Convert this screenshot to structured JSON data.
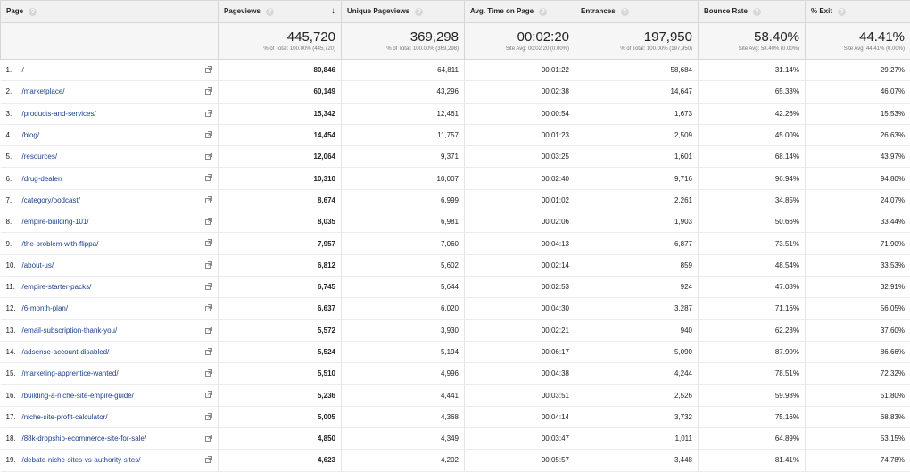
{
  "columns": {
    "page": "Page",
    "pageviews": "Pageviews",
    "unique": "Unique Pageviews",
    "avg_time": "Avg. Time on Page",
    "entrances": "Entrances",
    "bounce": "Bounce Rate",
    "exit": "% Exit"
  },
  "help_glyph": "?",
  "sort_glyph": "↓",
  "totals": {
    "pageviews": {
      "value": "445,720",
      "sub": "% of Total: 100.00% (445,720)"
    },
    "unique": {
      "value": "369,298",
      "sub": "% of Total: 100.00% (369,298)"
    },
    "avg_time": {
      "value": "00:02:20",
      "sub": "Site Avg: 00:02:20 (0.00%)"
    },
    "entrances": {
      "value": "197,950",
      "sub": "% of Total: 100.00% (197,950)"
    },
    "bounce": {
      "value": "58.40%",
      "sub": "Site Avg: 58.40% (0.00%)"
    },
    "exit": {
      "value": "44.41%",
      "sub": "Site Avg: 44.41% (0.00%)"
    }
  },
  "rows": [
    {
      "num": "1.",
      "page": "/",
      "pv": "80,846",
      "upv": "64,811",
      "avg": "00:01:22",
      "ent": "58,684",
      "br": "31.14%",
      "exit": "29.27%"
    },
    {
      "num": "2.",
      "page": "/marketplace/",
      "pv": "60,149",
      "upv": "43,296",
      "avg": "00:02:38",
      "ent": "14,647",
      "br": "65.33%",
      "exit": "46.07%"
    },
    {
      "num": "3.",
      "page": "/products-and-services/",
      "pv": "15,342",
      "upv": "12,461",
      "avg": "00:00:54",
      "ent": "1,673",
      "br": "42.26%",
      "exit": "15.53%"
    },
    {
      "num": "4.",
      "page": "/blog/",
      "pv": "14,454",
      "upv": "11,757",
      "avg": "00:01:23",
      "ent": "2,509",
      "br": "45.00%",
      "exit": "26.63%"
    },
    {
      "num": "5.",
      "page": "/resources/",
      "pv": "12,064",
      "upv": "9,371",
      "avg": "00:03:25",
      "ent": "1,601",
      "br": "68.14%",
      "exit": "43.97%"
    },
    {
      "num": "6.",
      "page": "/drug-dealer/",
      "pv": "10,310",
      "upv": "10,007",
      "avg": "00:02:40",
      "ent": "9,716",
      "br": "96.94%",
      "exit": "94.80%"
    },
    {
      "num": "7.",
      "page": "/category/podcast/",
      "pv": "8,674",
      "upv": "6,999",
      "avg": "00:01:02",
      "ent": "2,261",
      "br": "34.85%",
      "exit": "24.07%"
    },
    {
      "num": "8.",
      "page": "/empire-building-101/",
      "pv": "8,035",
      "upv": "6,981",
      "avg": "00:02:06",
      "ent": "1,903",
      "br": "50.66%",
      "exit": "33.44%"
    },
    {
      "num": "9.",
      "page": "/the-problem-with-flippa/",
      "pv": "7,957",
      "upv": "7,060",
      "avg": "00:04:13",
      "ent": "6,877",
      "br": "73.51%",
      "exit": "71.90%"
    },
    {
      "num": "10.",
      "page": "/about-us/",
      "pv": "6,812",
      "upv": "5,602",
      "avg": "00:02:14",
      "ent": "859",
      "br": "48.54%",
      "exit": "33.53%"
    },
    {
      "num": "11.",
      "page": "/empire-starter-packs/",
      "pv": "6,745",
      "upv": "5,644",
      "avg": "00:02:53",
      "ent": "924",
      "br": "47.08%",
      "exit": "32.91%"
    },
    {
      "num": "12.",
      "page": "/6-month-plan/",
      "pv": "6,637",
      "upv": "6,020",
      "avg": "00:04:30",
      "ent": "3,287",
      "br": "71.16%",
      "exit": "56.05%"
    },
    {
      "num": "13.",
      "page": "/email-subscription-thank-you/",
      "pv": "5,572",
      "upv": "3,930",
      "avg": "00:02:21",
      "ent": "940",
      "br": "62.23%",
      "exit": "37.60%"
    },
    {
      "num": "14.",
      "page": "/adsense-account-disabled/",
      "pv": "5,524",
      "upv": "5,194",
      "avg": "00:06:17",
      "ent": "5,090",
      "br": "87.90%",
      "exit": "86.66%"
    },
    {
      "num": "15.",
      "page": "/marketing-apprentice-wanted/",
      "pv": "5,510",
      "upv": "4,996",
      "avg": "00:04:38",
      "ent": "4,244",
      "br": "78.51%",
      "exit": "72.32%"
    },
    {
      "num": "16.",
      "page": "/building-a-niche-site-empire-guide/",
      "pv": "5,236",
      "upv": "4,441",
      "avg": "00:03:51",
      "ent": "2,526",
      "br": "59.98%",
      "exit": "51.80%"
    },
    {
      "num": "17.",
      "page": "/niche-site-profit-calculator/",
      "pv": "5,005",
      "upv": "4,368",
      "avg": "00:04:14",
      "ent": "3,732",
      "br": "75.16%",
      "exit": "68.83%"
    },
    {
      "num": "18.",
      "page": "/88k-dropship-ecommerce-site-for-sale/",
      "pv": "4,850",
      "upv": "4,349",
      "avg": "00:03:47",
      "ent": "1,011",
      "br": "64.89%",
      "exit": "53.15%"
    },
    {
      "num": "19.",
      "page": "/debate-niche-sites-vs-authority-sites/",
      "pv": "4,623",
      "upv": "4,202",
      "avg": "00:05:57",
      "ent": "3,448",
      "br": "81.41%",
      "exit": "74.78%"
    }
  ]
}
